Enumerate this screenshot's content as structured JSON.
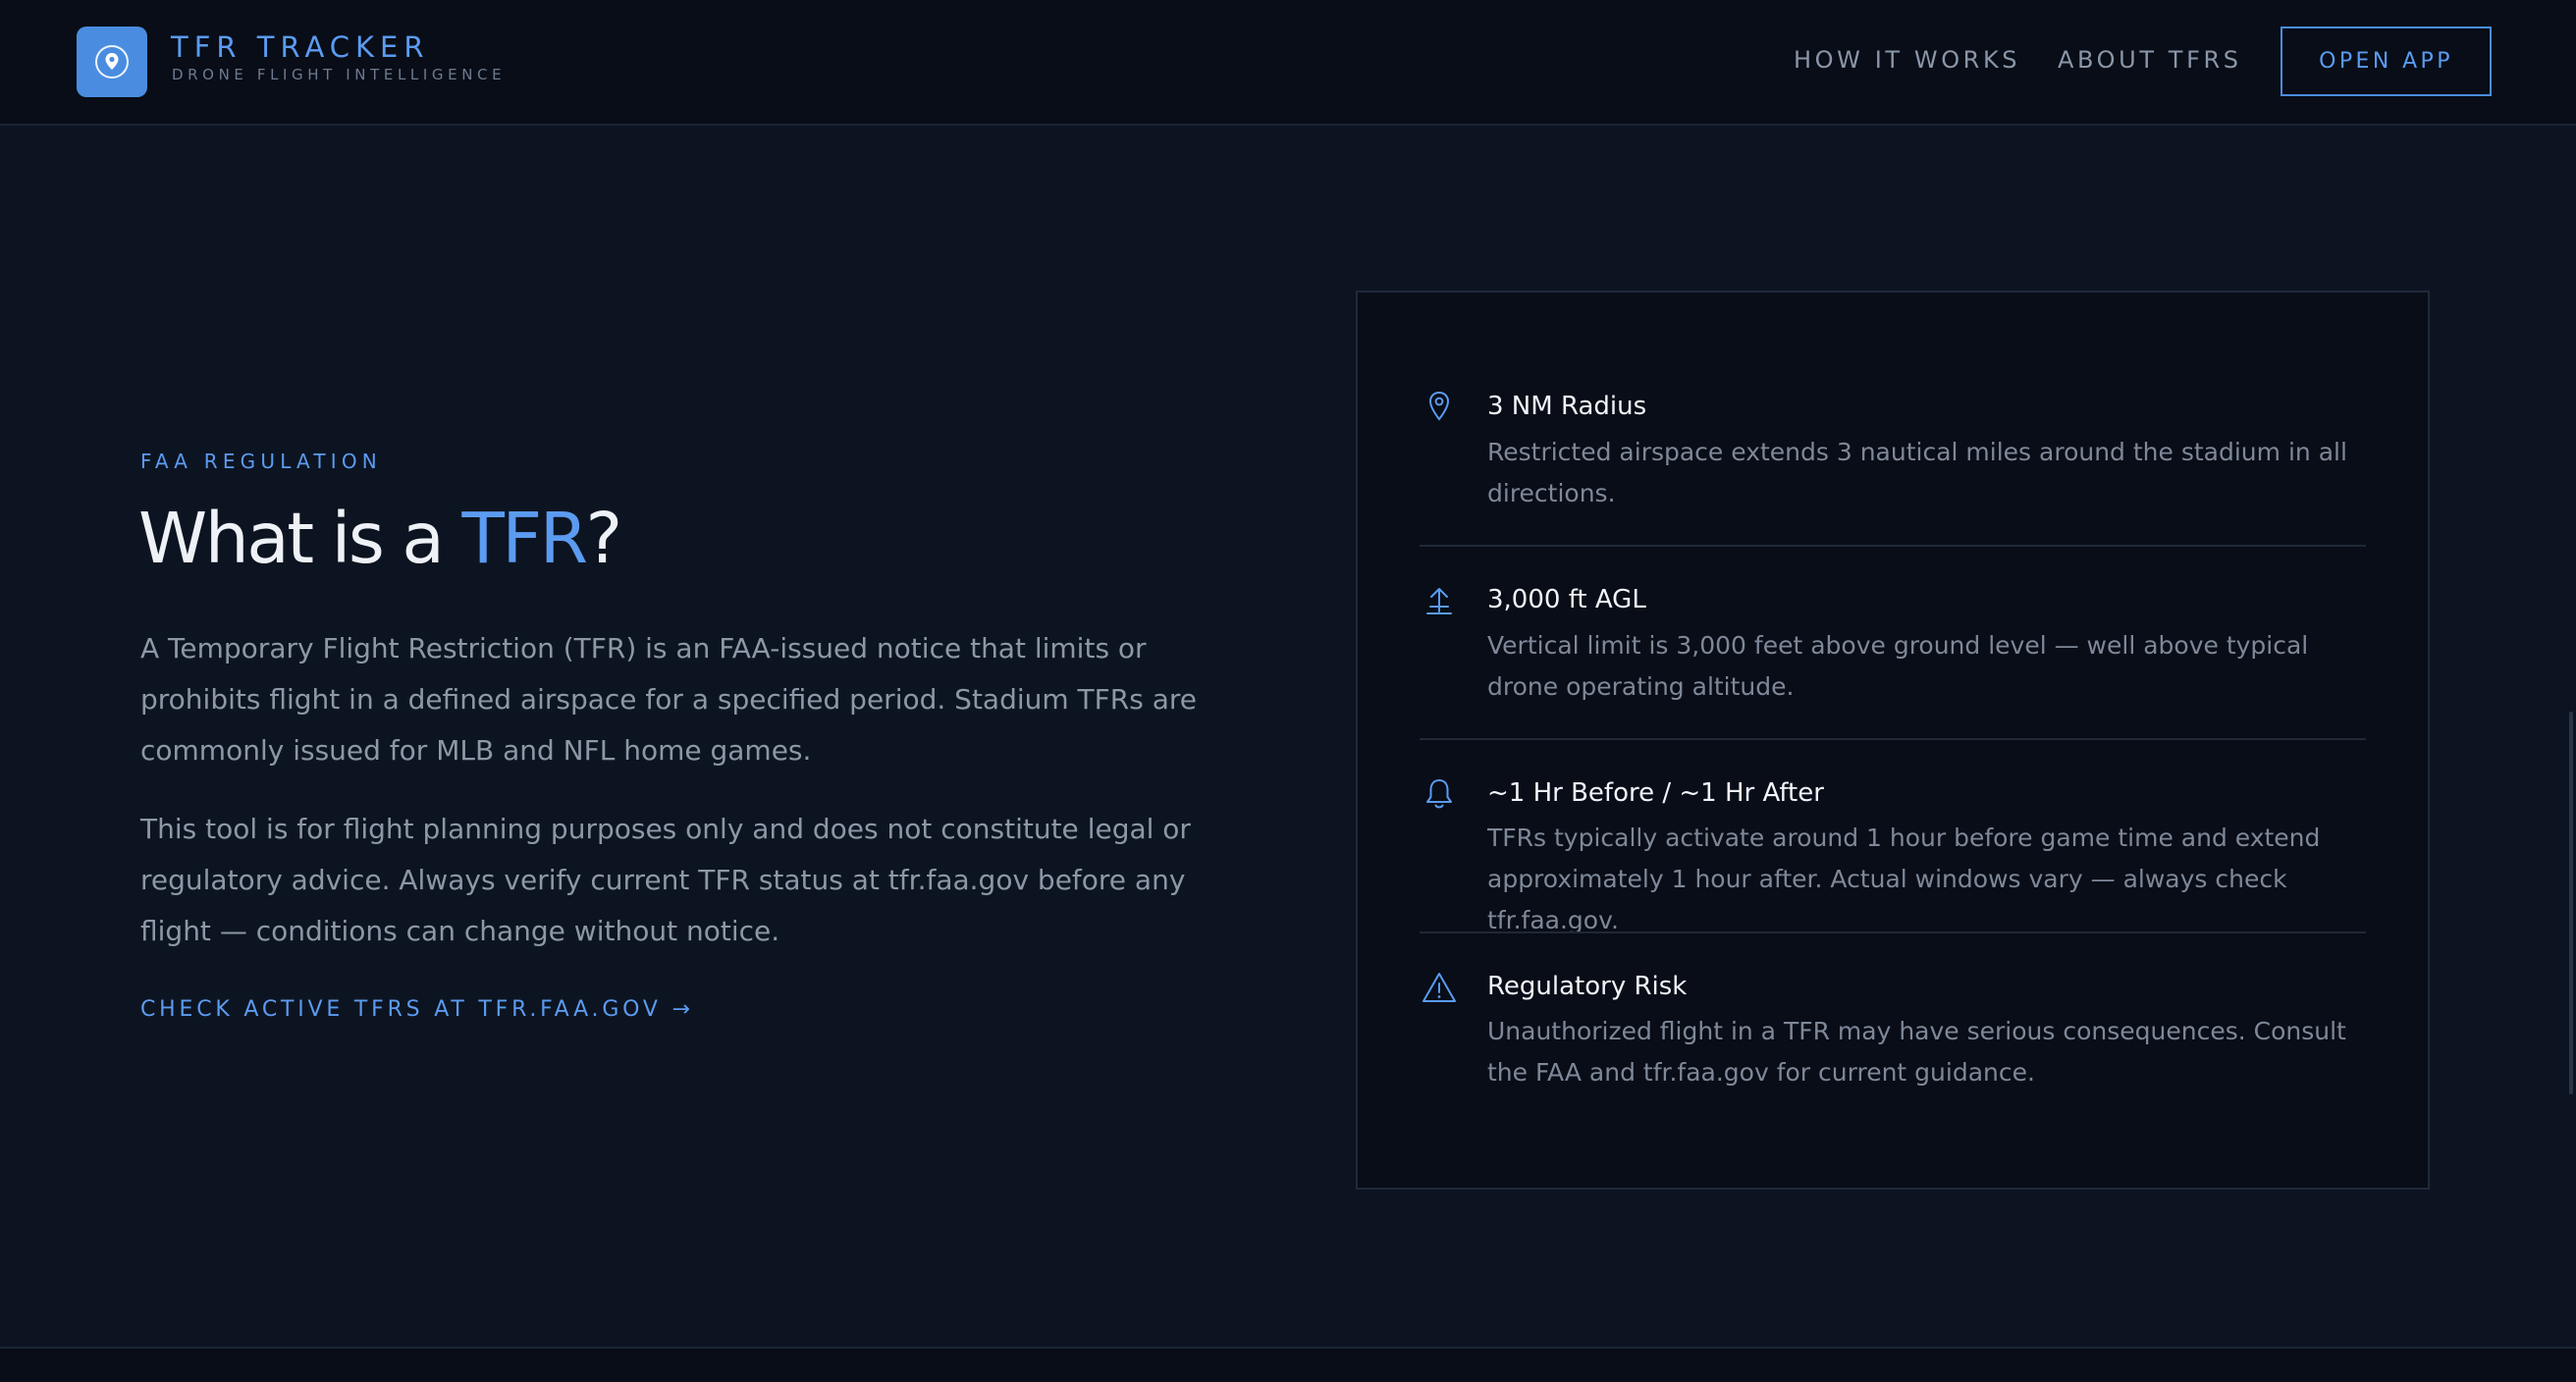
{
  "nav": {
    "brand_title": "TFR TRACKER",
    "brand_subtitle": "DRONE FLIGHT INTELLIGENCE",
    "links": [
      {
        "label": "HOW IT WORKS"
      },
      {
        "label": "ABOUT TFRS"
      }
    ],
    "cta_label": "OPEN APP",
    "logo_icon": "location-pin-icon"
  },
  "intro": {
    "eyebrow": "FAA REGULATION",
    "heading_prefix": "What is a ",
    "heading_accent": "TFR",
    "heading_suffix": "?",
    "paragraphs": [
      "A Temporary Flight Restriction (TFR) is an FAA-issued notice that limits or prohibits flight in a defined airspace for a specified period. Stadium TFRs are commonly issued for MLB and NFL home games.",
      "This tool is for flight planning purposes only and does not constitute legal or regulatory advice. Always verify current TFR status at tfr.faa.gov before any flight — conditions can change without notice."
    ],
    "link_label": "CHECK ACTIVE TFRS AT TFR.FAA.GOV →"
  },
  "facts": [
    {
      "icon": "map-pin-icon",
      "title": "3 NM Radius",
      "description": "Restricted airspace extends 3 nautical miles around the stadium in all directions."
    },
    {
      "icon": "altitude-arrow-icon",
      "title": "3,000 ft AGL",
      "description": "Vertical limit is 3,000 feet above ground level — well above typical drone operating altitude."
    },
    {
      "icon": "bell-icon",
      "title": "~1 Hr Before / ~1 Hr After",
      "description": "TFRs typically activate around 1 hour before game time and extend approximately 1 hour after. Actual windows vary — always check tfr.faa.gov."
    },
    {
      "icon": "warning-triangle-icon",
      "title": "Regulatory Risk",
      "description": "Unauthorized flight in a TFR may have serious consequences. Consult the FAA and tfr.faa.gov for current guidance."
    }
  ],
  "colors": {
    "background": "#0d1421",
    "nav_background": "#080d17",
    "accent": "#5b9bf0",
    "logo_fill": "#4a8de0",
    "heading_text": "#eef2f7",
    "body_text": "#8d97a6"
  }
}
